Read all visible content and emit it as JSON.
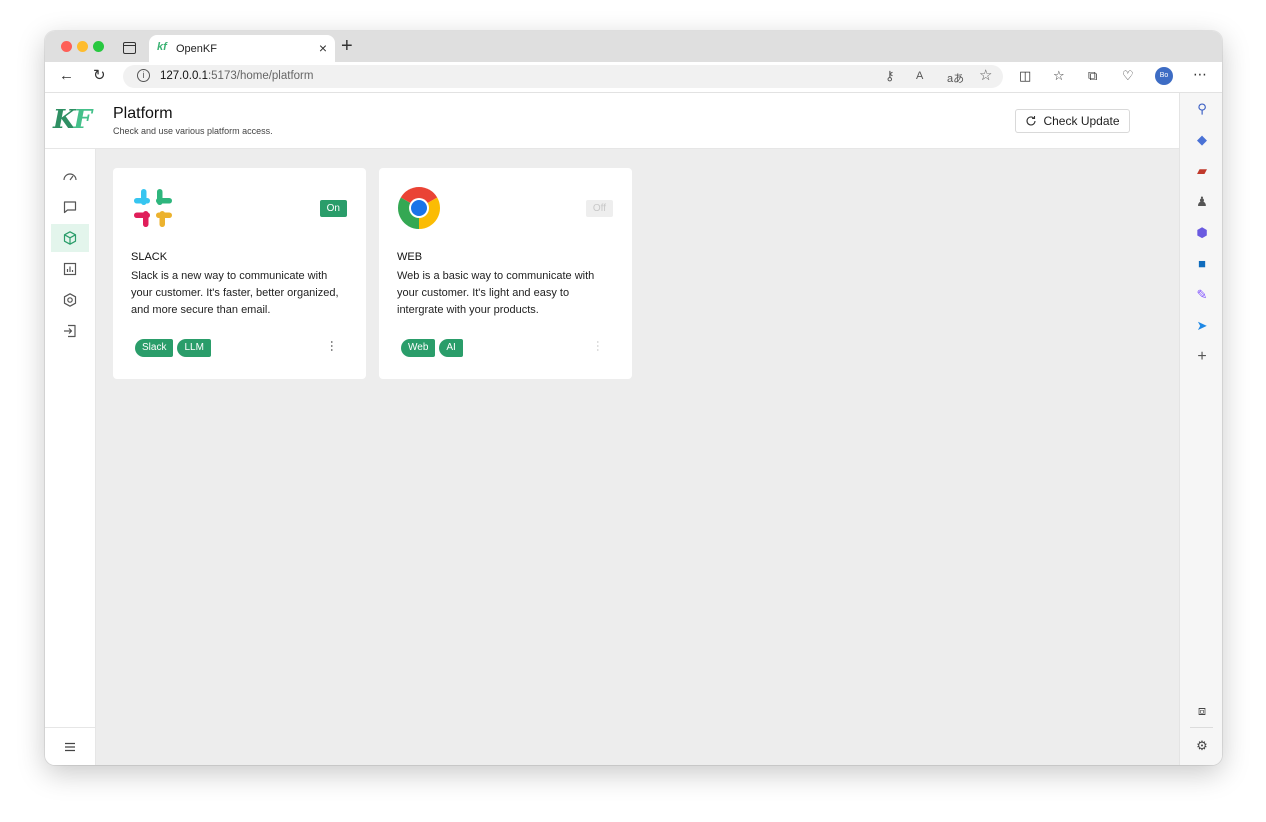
{
  "browser": {
    "tab_title": "OpenKF",
    "tab_favicon": "kf",
    "url_host": "127.0.0.1",
    "url_rest": ":5173/home/platform",
    "profile_initials": "Bo"
  },
  "app": {
    "logo_text_1": "K",
    "logo_text_2": "F",
    "page_title": "Platform",
    "page_subtitle": "Check and use various platform access.",
    "check_update_label": "Check Update",
    "accent_color": "#2a9d6a"
  },
  "sidebar": {
    "items": [
      {
        "icon": "dashboard-icon",
        "active": false
      },
      {
        "icon": "message-icon",
        "active": false
      },
      {
        "icon": "cube-icon",
        "active": true
      },
      {
        "icon": "chart-icon",
        "active": false
      },
      {
        "icon": "settings-hexagon-icon",
        "active": false
      },
      {
        "icon": "logout-icon",
        "active": false
      }
    ],
    "collapse_icon": "menu-icon"
  },
  "platforms": [
    {
      "name": "SLACK",
      "description": "Slack is a new way to communicate with your customer. It's faster, better organized, and more secure than email.",
      "status": "On",
      "enabled": true,
      "tags": [
        "Slack",
        "LLM"
      ],
      "logo": "slack-logo"
    },
    {
      "name": "WEB",
      "description": "Web is a basic way to communicate with your customer. It's light and easy to intergrate with your products.",
      "status": "Off",
      "enabled": false,
      "tags": [
        "Web",
        "AI"
      ],
      "logo": "chrome-logo"
    }
  ],
  "more_glyph": "⋯"
}
